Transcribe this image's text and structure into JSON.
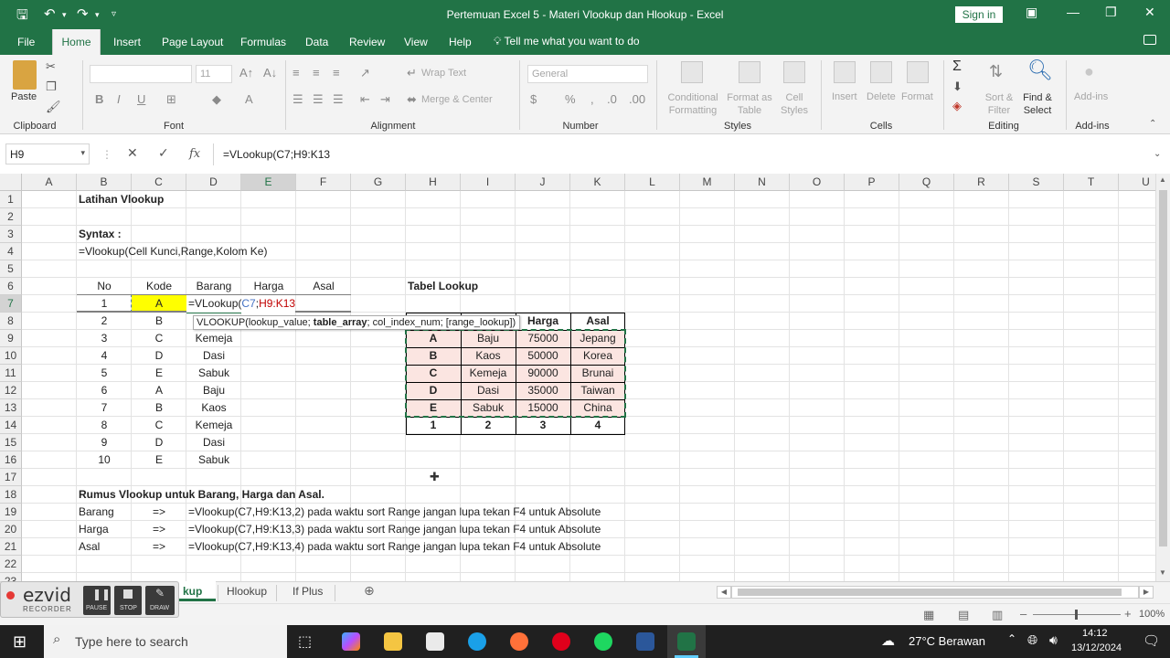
{
  "window": {
    "title": "Pertemuan Excel 5 - Materi Vlookup dan Hlookup  -  Excel",
    "sign_in": "Sign in"
  },
  "ribbon_tabs": [
    "File",
    "Home",
    "Insert",
    "Page Layout",
    "Formulas",
    "Data",
    "Review",
    "View",
    "Help"
  ],
  "tell_me": "Tell me what you want to do",
  "ribbon": {
    "paste": "Paste",
    "groups": [
      "Clipboard",
      "Font",
      "Alignment",
      "Number",
      "Styles",
      "Cells",
      "Editing",
      "Add-ins"
    ],
    "font_size": "11",
    "wrap_text": "Wrap Text",
    "merge_center": "Merge & Center",
    "number_format": "General",
    "conditional_formatting": [
      "Conditional",
      "Formatting"
    ],
    "format_as_table": [
      "Format as",
      "Table"
    ],
    "cell_styles": [
      "Cell",
      "Styles"
    ],
    "insert": "Insert",
    "delete": "Delete",
    "format": "Format",
    "sort_filter": [
      "Sort &",
      "Filter"
    ],
    "find_select": [
      "Find &",
      "Select"
    ],
    "addins": "Add-ins"
  },
  "formula_bar": {
    "name_box": "H9",
    "fx": "fx",
    "content": "=VLookup(C7;H9:K13"
  },
  "columns": [
    "A",
    "B",
    "C",
    "D",
    "E",
    "F",
    "G",
    "H",
    "I",
    "J",
    "K",
    "L",
    "M",
    "N",
    "O",
    "P",
    "Q",
    "R",
    "S",
    "T",
    "U"
  ],
  "rows": [
    "1",
    "2",
    "3",
    "4",
    "5",
    "6",
    "7",
    "8",
    "9",
    "10",
    "11",
    "12",
    "13",
    "14",
    "15",
    "16",
    "17",
    "18",
    "19",
    "20",
    "21",
    "22",
    "23"
  ],
  "sheet": {
    "title": "Latihan Vlookup",
    "syntax_label": "Syntax :",
    "syntax": "=Vlookup(Cell Kunci,Range,Kolom Ke)",
    "headers": [
      "No",
      "Kode",
      "Barang",
      "Harga",
      "Asal"
    ],
    "editing_prefix": "=VLookup(",
    "editing_ref1": "C7",
    "editing_sep": ";",
    "editing_ref2": "H9:K13",
    "tooltip_pre": "VLOOKUP(lookup_value; ",
    "tooltip_bold": "table_array",
    "tooltip_post": "; col_index_num; [range_lookup])",
    "data_rows": [
      {
        "no": "1",
        "kode": "A",
        "barang": ""
      },
      {
        "no": "2",
        "kode": "B",
        "barang": ""
      },
      {
        "no": "3",
        "kode": "C",
        "barang": "Kemeja"
      },
      {
        "no": "4",
        "kode": "D",
        "barang": "Dasi"
      },
      {
        "no": "5",
        "kode": "E",
        "barang": "Sabuk"
      },
      {
        "no": "6",
        "kode": "A",
        "barang": "Baju"
      },
      {
        "no": "7",
        "kode": "B",
        "barang": "Kaos"
      },
      {
        "no": "8",
        "kode": "C",
        "barang": "Kemeja"
      },
      {
        "no": "9",
        "kode": "D",
        "barang": "Dasi"
      },
      {
        "no": "10",
        "kode": "E",
        "barang": "Sabuk"
      }
    ],
    "lookup_title": "Tabel Lookup",
    "lookup_headers": [
      "Harga",
      "Asal"
    ],
    "lookup_rows": [
      {
        "kode": "A",
        "barang": "Baju",
        "harga": "75000",
        "asal": "Jepang"
      },
      {
        "kode": "B",
        "barang": "Kaos",
        "harga": "50000",
        "asal": "Korea"
      },
      {
        "kode": "C",
        "barang": "Kemeja",
        "harga": "90000",
        "asal": "Brunai"
      },
      {
        "kode": "D",
        "barang": "Dasi",
        "harga": "35000",
        "asal": "Taiwan"
      },
      {
        "kode": "E",
        "barang": "Sabuk",
        "harga": "15000",
        "asal": "China"
      }
    ],
    "col_index": [
      "1",
      "2",
      "3",
      "4"
    ],
    "rumus_title": "Rumus Vlookup untuk Barang, Harga dan Asal.",
    "rumus": [
      {
        "label": "Barang",
        "arrow": "=>",
        "formula": "=Vlookup(C7,H9:K13,2) pada waktu sort Range jangan lupa tekan F4 untuk Absolute"
      },
      {
        "label": "Harga",
        "arrow": "=>",
        "formula": "=Vlookup(C7,H9:K13,3) pada waktu sort Range jangan lupa tekan F4 untuk Absolute"
      },
      {
        "label": "Asal",
        "arrow": "=>",
        "formula": "=Vlookup(C7,H9:K13,4) pada waktu sort Range jangan lupa tekan F4 untuk Absolute"
      }
    ]
  },
  "sheet_tabs": [
    "kup",
    "Hlookup",
    "If Plus"
  ],
  "recorder": {
    "brand": "ezvid",
    "sub": "RECORDER",
    "buttons": [
      "PAUSE",
      "STOP",
      "DRAW"
    ]
  },
  "status": {
    "zoom": "100%"
  },
  "taskbar": {
    "search": "Type here to search",
    "weather": "27°C  Berawan",
    "time": "14:12",
    "date": "13/12/2024"
  },
  "colors": {
    "excel_green": "#217346",
    "lookup_fill": "#fbe5e1",
    "active_cell": "#ffff00",
    "ref_blue": "#4472c4",
    "ref_red": "#c00000"
  }
}
